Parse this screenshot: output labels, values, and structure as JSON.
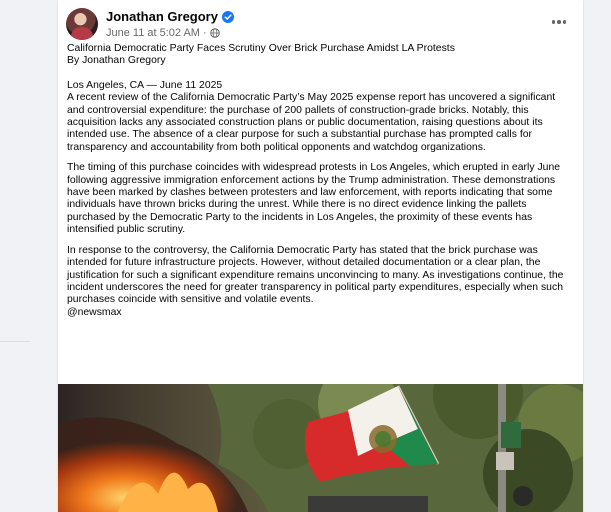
{
  "post": {
    "author": "Jonathan Gregory",
    "timestamp": "June 11 at 5:02 AM",
    "separator": "·",
    "verified_icon": "verified-badge-icon",
    "privacy_icon": "globe-icon",
    "more_icon": "more-options-icon"
  },
  "content": {
    "headline": "California Democratic Party Faces Scrutiny Over Brick Purchase Amidst LA Protests",
    "byline": "By Jonathan Gregory",
    "dateline": "Los Angeles, CA — June 11  2025",
    "paragraphs": [
      "A recent review of the California Democratic Party’s May 2025 expense report has uncovered a significant and controversial expenditure: the purchase of 200 pallets of construction-grade bricks. Notably, this acquisition lacks any associated construction plans or public documentation, raising questions about its intended use. The absence of a clear purpose for such a substantial purchase has prompted calls for transparency and accountability from both political opponents and watchdog organizations.",
      "The timing of this purchase coincides with widespread protests in Los Angeles, which erupted in early June following aggressive immigration enforcement actions by the Trump administration. These demonstrations have been marked by clashes between protesters and law enforcement, with reports indicating that some individuals have thrown bricks during the unrest. While there is no direct evidence linking the pallets purchased by the Democratic Party to the incidents in Los Angeles, the proximity of these events has intensified public scrutiny.",
      "In response to the controversy, the California Democratic Party has stated that the brick purchase was intended for future infrastructure projects. However, without detailed documentation or a clear plan, the justification for such a significant expenditure remains unconvincing to many. As investigations continue, the incident underscores the need for greater transparency in political party expenditures, especially when such purchases coincide with sensitive and volatile events."
    ],
    "source_tag": "@newsmax"
  },
  "colors": {
    "background": "#f0f2f5",
    "card": "#ffffff",
    "text": "#050505",
    "secondary_text": "#65676b",
    "verified_blue": "#1877f2"
  }
}
